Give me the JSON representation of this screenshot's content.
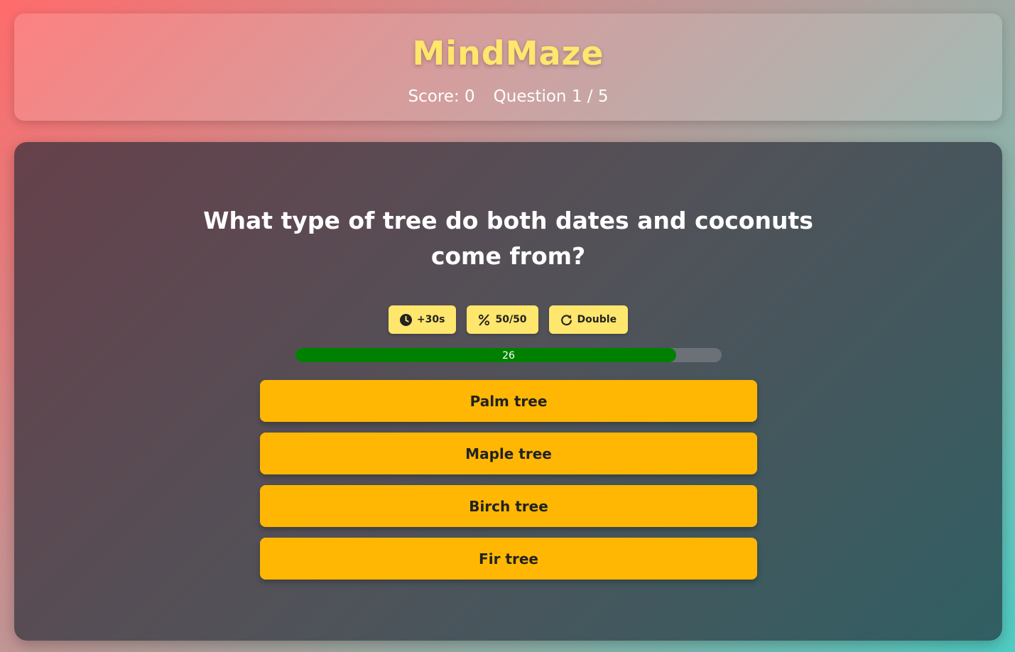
{
  "header": {
    "title": "MindMaze",
    "score_label": "Score: 0",
    "question_label": "Question 1 / 5"
  },
  "question": {
    "text": "What type of tree do both dates and coconuts come from?"
  },
  "powerups": [
    {
      "label": "+30s",
      "icon": "clock-icon"
    },
    {
      "label": "50/50",
      "icon": "percent-icon"
    },
    {
      "label": "Double",
      "icon": "redo-icon"
    }
  ],
  "timer": {
    "value": "26",
    "fill_fraction": 0.893
  },
  "answers": [
    {
      "label": "Palm tree"
    },
    {
      "label": "Maple tree"
    },
    {
      "label": "Birch tree"
    },
    {
      "label": "Fir tree"
    }
  ],
  "colors": {
    "accent": "#ffe66d",
    "answer_bg": "#ffb703",
    "timer_fill": "#008000"
  }
}
